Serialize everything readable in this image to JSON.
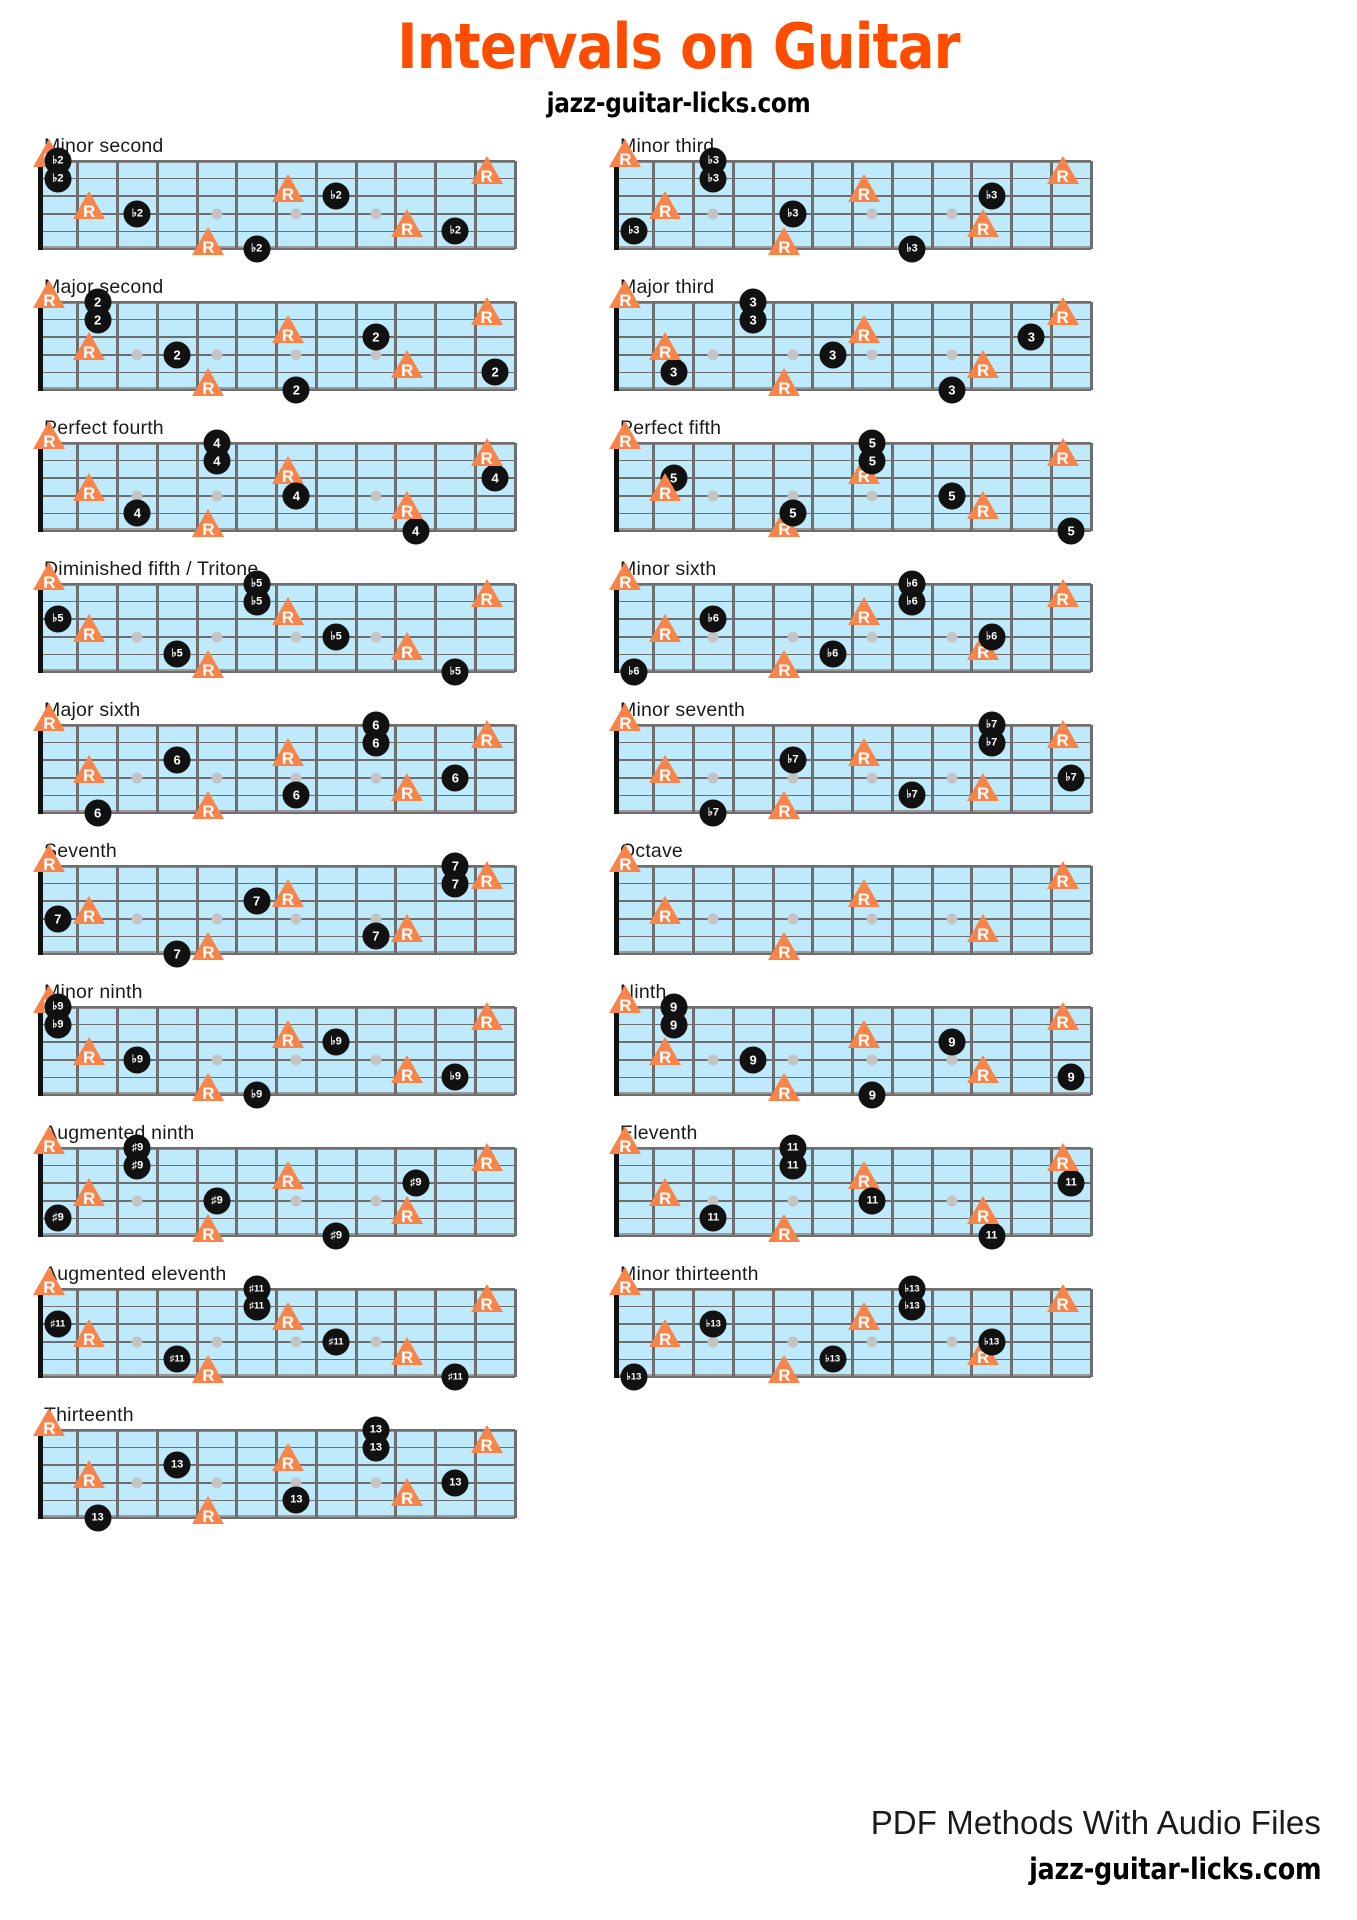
{
  "header": {
    "title": "Intervals on Guitar",
    "subtitle": "jazz-guitar-licks.com"
  },
  "footer": {
    "line1": "PDF Methods With Audio Files",
    "line2": "jazz-guitar-licks.com"
  },
  "fretboard": {
    "strings": 6,
    "frets": 12,
    "inlay_frets": [
      3,
      5,
      7,
      9
    ],
    "inlay_string_gap": "between string 3 and 4",
    "root_label": "R",
    "root_color": "#F8844A",
    "interval_color": "#111111",
    "board_color": "#BFEAFB"
  },
  "diagrams": [
    {
      "label": "Minor second",
      "interval_label": "♭2",
      "notes": [
        {
          "t": "R",
          "s": 6,
          "f": 0
        },
        {
          "t": "I",
          "s": 6,
          "f": 1
        },
        {
          "t": "R",
          "s": 1,
          "f": 5
        },
        {
          "t": "I",
          "s": 1,
          "f": 6
        },
        {
          "t": "R",
          "s": 4,
          "f": 7
        },
        {
          "t": "I",
          "s": 4,
          "f": 8
        },
        {
          "t": "R",
          "s": 2,
          "f": 10
        },
        {
          "t": "I",
          "s": 2,
          "f": 11
        },
        {
          "t": "R",
          "s": 5,
          "f": 12
        },
        {
          "t": "I",
          "s": 5,
          "f": 13
        },
        {
          "t": "R",
          "s": 3,
          "f": 14
        },
        {
          "t": "I",
          "s": 3,
          "f": 15
        }
      ]
    },
    {
      "label": "Minor third",
      "interval_label": "♭3",
      "notes": [
        {
          "t": "R",
          "s": 6,
          "f": 0
        },
        {
          "t": "I",
          "s": 6,
          "f": 3
        },
        {
          "t": "R",
          "s": 1,
          "f": 5
        },
        {
          "t": "I",
          "s": 1,
          "f": 8
        },
        {
          "t": "R",
          "s": 4,
          "f": 7
        },
        {
          "t": "I",
          "s": 4,
          "f": 10
        },
        {
          "t": "R",
          "s": 2,
          "f": 10
        },
        {
          "t": "I",
          "s": 2,
          "f": 13
        },
        {
          "t": "R",
          "s": 5,
          "f": 12
        },
        {
          "t": "I",
          "s": 5,
          "f": 15
        },
        {
          "t": "R",
          "s": 3,
          "f": 14
        },
        {
          "t": "I",
          "s": 3,
          "f": 17
        }
      ]
    },
    {
      "label": "Major second",
      "interval_label": "2",
      "notes": [
        {
          "t": "R",
          "s": 6,
          "f": 0
        },
        {
          "t": "I",
          "s": 6,
          "f": 2
        },
        {
          "t": "R",
          "s": 1,
          "f": 5
        },
        {
          "t": "I",
          "s": 1,
          "f": 7
        },
        {
          "t": "R",
          "s": 4,
          "f": 7
        },
        {
          "t": "I",
          "s": 4,
          "f": 9
        },
        {
          "t": "R",
          "s": 2,
          "f": 10
        },
        {
          "t": "I",
          "s": 2,
          "f": 12
        },
        {
          "t": "R",
          "s": 5,
          "f": 12
        },
        {
          "t": "I",
          "s": 5,
          "f": 14
        },
        {
          "t": "R",
          "s": 3,
          "f": 14
        },
        {
          "t": "I",
          "s": 3,
          "f": 16
        }
      ]
    },
    {
      "label": "Major third",
      "interval_label": "3",
      "notes": [
        {
          "t": "R",
          "s": 6,
          "f": 0
        },
        {
          "t": "I",
          "s": 6,
          "f": 4
        },
        {
          "t": "R",
          "s": 1,
          "f": 5
        },
        {
          "t": "I",
          "s": 1,
          "f": 9
        },
        {
          "t": "R",
          "s": 4,
          "f": 7
        },
        {
          "t": "I",
          "s": 4,
          "f": 11
        },
        {
          "t": "R",
          "s": 2,
          "f": 10
        },
        {
          "t": "I",
          "s": 2,
          "f": 14
        },
        {
          "t": "R",
          "s": 5,
          "f": 12
        },
        {
          "t": "I",
          "s": 5,
          "f": 16
        },
        {
          "t": "R",
          "s": 3,
          "f": 14
        },
        {
          "t": "I",
          "s": 3,
          "f": 18
        }
      ]
    },
    {
      "label": "Perfect fourth",
      "interval_label": "4",
      "notes": [
        {
          "t": "R",
          "s": 6,
          "f": 0
        },
        {
          "t": "I",
          "s": 6,
          "f": 5
        },
        {
          "t": "R",
          "s": 1,
          "f": 5
        },
        {
          "t": "I",
          "s": 1,
          "f": 10
        },
        {
          "t": "R",
          "s": 4,
          "f": 7
        },
        {
          "t": "I",
          "s": 4,
          "f": 12
        },
        {
          "t": "R",
          "s": 2,
          "f": 10
        },
        {
          "t": "I",
          "s": 2,
          "f": 15
        },
        {
          "t": "R",
          "s": 5,
          "f": 12
        },
        {
          "t": "I",
          "s": 5,
          "f": 17
        },
        {
          "t": "R",
          "s": 3,
          "f": 14
        },
        {
          "t": "I",
          "s": 3,
          "f": 19
        }
      ]
    },
    {
      "label": "Perfect fifth",
      "interval_label": "5",
      "notes": [
        {
          "t": "R",
          "s": 6,
          "f": 0
        },
        {
          "t": "I",
          "s": 6,
          "f": 7
        },
        {
          "t": "R",
          "s": 1,
          "f": 5
        },
        {
          "t": "I",
          "s": 1,
          "f": 12
        },
        {
          "t": "R",
          "s": 4,
          "f": 7
        },
        {
          "t": "I",
          "s": 4,
          "f": 14
        },
        {
          "t": "R",
          "s": 2,
          "f": 10
        },
        {
          "t": "I",
          "s": 2,
          "f": 17
        },
        {
          "t": "R",
          "s": 5,
          "f": 12
        },
        {
          "t": "I",
          "s": 5,
          "f": 19
        },
        {
          "t": "R",
          "s": 3,
          "f": 14
        },
        {
          "t": "I",
          "s": 3,
          "f": 21
        }
      ]
    },
    {
      "label": "Diminished fifth / Tritone",
      "interval_label": "♭5",
      "notes": [
        {
          "t": "R",
          "s": 6,
          "f": 0
        },
        {
          "t": "I",
          "s": 6,
          "f": 6
        },
        {
          "t": "R",
          "s": 1,
          "f": 5
        },
        {
          "t": "I",
          "s": 1,
          "f": 11
        },
        {
          "t": "R",
          "s": 4,
          "f": 7
        },
        {
          "t": "I",
          "s": 4,
          "f": 13
        },
        {
          "t": "R",
          "s": 2,
          "f": 10
        },
        {
          "t": "I",
          "s": 2,
          "f": 16
        },
        {
          "t": "R",
          "s": 5,
          "f": 12
        },
        {
          "t": "I",
          "s": 5,
          "f": 18
        },
        {
          "t": "R",
          "s": 3,
          "f": 14
        },
        {
          "t": "I",
          "s": 3,
          "f": 20
        }
      ]
    },
    {
      "label": "Minor sixth",
      "interval_label": "♭6",
      "notes": [
        {
          "t": "R",
          "s": 6,
          "f": 0
        },
        {
          "t": "I",
          "s": 6,
          "f": 8
        },
        {
          "t": "R",
          "s": 1,
          "f": 5
        },
        {
          "t": "I",
          "s": 1,
          "f": 13
        },
        {
          "t": "R",
          "s": 4,
          "f": 7
        },
        {
          "t": "I",
          "s": 4,
          "f": 15
        },
        {
          "t": "R",
          "s": 2,
          "f": 10
        },
        {
          "t": "I",
          "s": 2,
          "f": 18
        },
        {
          "t": "R",
          "s": 5,
          "f": 12
        },
        {
          "t": "I",
          "s": 5,
          "f": 20
        },
        {
          "t": "R",
          "s": 3,
          "f": 14
        },
        {
          "t": "I",
          "s": 3,
          "f": 22
        }
      ]
    },
    {
      "label": "Major sixth",
      "interval_label": "6",
      "notes": [
        {
          "t": "R",
          "s": 6,
          "f": 0
        },
        {
          "t": "I",
          "s": 6,
          "f": 9
        },
        {
          "t": "R",
          "s": 1,
          "f": 5
        },
        {
          "t": "I",
          "s": 1,
          "f": 14
        },
        {
          "t": "R",
          "s": 4,
          "f": 7
        },
        {
          "t": "I",
          "s": 4,
          "f": 16
        },
        {
          "t": "R",
          "s": 2,
          "f": 10
        },
        {
          "t": "I",
          "s": 2,
          "f": 19
        },
        {
          "t": "R",
          "s": 5,
          "f": 12
        },
        {
          "t": "I",
          "s": 5,
          "f": 21
        },
        {
          "t": "R",
          "s": 3,
          "f": 14
        },
        {
          "t": "I",
          "s": 3,
          "f": 23
        }
      ]
    },
    {
      "label": "Minor seventh",
      "interval_label": "♭7",
      "notes": [
        {
          "t": "R",
          "s": 6,
          "f": 0
        },
        {
          "t": "I",
          "s": 6,
          "f": 10
        },
        {
          "t": "R",
          "s": 1,
          "f": 5
        },
        {
          "t": "I",
          "s": 1,
          "f": 15
        },
        {
          "t": "R",
          "s": 4,
          "f": 7
        },
        {
          "t": "I",
          "s": 4,
          "f": 17
        },
        {
          "t": "R",
          "s": 2,
          "f": 10
        },
        {
          "t": "I",
          "s": 2,
          "f": 20
        },
        {
          "t": "R",
          "s": 5,
          "f": 12
        },
        {
          "t": "I",
          "s": 5,
          "f": 22
        },
        {
          "t": "R",
          "s": 3,
          "f": 14
        },
        {
          "t": "I",
          "s": 3,
          "f": 24
        }
      ]
    },
    {
      "label": "Seventh",
      "interval_label": "7",
      "notes": [
        {
          "t": "R",
          "s": 6,
          "f": 0
        },
        {
          "t": "I",
          "s": 6,
          "f": 11
        },
        {
          "t": "R",
          "s": 1,
          "f": 5
        },
        {
          "t": "I",
          "s": 1,
          "f": 16
        },
        {
          "t": "R",
          "s": 4,
          "f": 7
        },
        {
          "t": "I",
          "s": 4,
          "f": 18
        },
        {
          "t": "R",
          "s": 2,
          "f": 10
        },
        {
          "t": "I",
          "s": 2,
          "f": 21
        },
        {
          "t": "R",
          "s": 5,
          "f": 12
        },
        {
          "t": "I",
          "s": 5,
          "f": 23
        },
        {
          "t": "R",
          "s": 3,
          "f": 14
        },
        {
          "t": "I",
          "s": 3,
          "f": 25
        }
      ]
    },
    {
      "label": "Octave",
      "interval_label": "",
      "notes": [
        {
          "t": "R",
          "s": 6,
          "f": 0
        },
        {
          "t": "R",
          "s": 1,
          "f": 5
        },
        {
          "t": "R",
          "s": 4,
          "f": 7
        },
        {
          "t": "R",
          "s": 2,
          "f": 10
        },
        {
          "t": "R",
          "s": 5,
          "f": 12
        },
        {
          "t": "R",
          "s": 3,
          "f": 14
        }
      ]
    },
    {
      "label": "Minor ninth",
      "interval_label": "♭9",
      "notes": [
        {
          "t": "R",
          "s": 6,
          "f": 0
        },
        {
          "t": "I",
          "s": 6,
          "f": 1
        },
        {
          "t": "R",
          "s": 1,
          "f": 5
        },
        {
          "t": "I",
          "s": 1,
          "f": 6
        },
        {
          "t": "R",
          "s": 4,
          "f": 7
        },
        {
          "t": "I",
          "s": 4,
          "f": 8
        },
        {
          "t": "R",
          "s": 2,
          "f": 10
        },
        {
          "t": "I",
          "s": 2,
          "f": 11
        },
        {
          "t": "R",
          "s": 5,
          "f": 12
        },
        {
          "t": "I",
          "s": 5,
          "f": 13
        },
        {
          "t": "R",
          "s": 3,
          "f": 14
        },
        {
          "t": "I",
          "s": 3,
          "f": 15
        }
      ]
    },
    {
      "label": "Ninth",
      "interval_label": "9",
      "notes": [
        {
          "t": "R",
          "s": 6,
          "f": 0
        },
        {
          "t": "I",
          "s": 6,
          "f": 2
        },
        {
          "t": "R",
          "s": 1,
          "f": 5
        },
        {
          "t": "I",
          "s": 1,
          "f": 7
        },
        {
          "t": "R",
          "s": 4,
          "f": 7
        },
        {
          "t": "I",
          "s": 4,
          "f": 9
        },
        {
          "t": "R",
          "s": 2,
          "f": 10
        },
        {
          "t": "I",
          "s": 2,
          "f": 12
        },
        {
          "t": "R",
          "s": 5,
          "f": 12
        },
        {
          "t": "I",
          "s": 5,
          "f": 14
        },
        {
          "t": "R",
          "s": 3,
          "f": 14
        },
        {
          "t": "I",
          "s": 3,
          "f": 16
        }
      ]
    },
    {
      "label": "Augmented ninth",
      "interval_label": "♯9",
      "notes": [
        {
          "t": "R",
          "s": 6,
          "f": 0
        },
        {
          "t": "I",
          "s": 6,
          "f": 3
        },
        {
          "t": "R",
          "s": 1,
          "f": 5
        },
        {
          "t": "I",
          "s": 1,
          "f": 8
        },
        {
          "t": "R",
          "s": 4,
          "f": 7
        },
        {
          "t": "I",
          "s": 4,
          "f": 10
        },
        {
          "t": "R",
          "s": 2,
          "f": 10
        },
        {
          "t": "I",
          "s": 2,
          "f": 13
        },
        {
          "t": "R",
          "s": 5,
          "f": 12
        },
        {
          "t": "I",
          "s": 5,
          "f": 15
        },
        {
          "t": "R",
          "s": 3,
          "f": 14
        },
        {
          "t": "I",
          "s": 3,
          "f": 17
        }
      ]
    },
    {
      "label": "Eleventh",
      "interval_label": "11",
      "notes": [
        {
          "t": "R",
          "s": 6,
          "f": 0
        },
        {
          "t": "I",
          "s": 6,
          "f": 5
        },
        {
          "t": "R",
          "s": 1,
          "f": 5
        },
        {
          "t": "I",
          "s": 1,
          "f": 10
        },
        {
          "t": "R",
          "s": 4,
          "f": 7
        },
        {
          "t": "I",
          "s": 4,
          "f": 12
        },
        {
          "t": "R",
          "s": 2,
          "f": 10
        },
        {
          "t": "I",
          "s": 2,
          "f": 15
        },
        {
          "t": "R",
          "s": 5,
          "f": 12
        },
        {
          "t": "I",
          "s": 5,
          "f": 17
        },
        {
          "t": "R",
          "s": 3,
          "f": 14
        },
        {
          "t": "I",
          "s": 3,
          "f": 19
        }
      ]
    },
    {
      "label": "Augmented eleventh",
      "interval_label": "♯11",
      "notes": [
        {
          "t": "R",
          "s": 6,
          "f": 0
        },
        {
          "t": "I",
          "s": 6,
          "f": 6
        },
        {
          "t": "R",
          "s": 1,
          "f": 5
        },
        {
          "t": "I",
          "s": 1,
          "f": 11
        },
        {
          "t": "R",
          "s": 4,
          "f": 7
        },
        {
          "t": "I",
          "s": 4,
          "f": 13
        },
        {
          "t": "R",
          "s": 2,
          "f": 10
        },
        {
          "t": "I",
          "s": 2,
          "f": 16
        },
        {
          "t": "R",
          "s": 5,
          "f": 12
        },
        {
          "t": "I",
          "s": 5,
          "f": 18
        },
        {
          "t": "R",
          "s": 3,
          "f": 14
        },
        {
          "t": "I",
          "s": 3,
          "f": 20
        }
      ]
    },
    {
      "label": "Minor thirteenth",
      "interval_label": "♭13",
      "notes": [
        {
          "t": "R",
          "s": 6,
          "f": 0
        },
        {
          "t": "I",
          "s": 6,
          "f": 8
        },
        {
          "t": "R",
          "s": 1,
          "f": 5
        },
        {
          "t": "I",
          "s": 1,
          "f": 13
        },
        {
          "t": "R",
          "s": 4,
          "f": 7
        },
        {
          "t": "I",
          "s": 4,
          "f": 15
        },
        {
          "t": "R",
          "s": 2,
          "f": 10
        },
        {
          "t": "I",
          "s": 2,
          "f": 18
        },
        {
          "t": "R",
          "s": 5,
          "f": 12
        },
        {
          "t": "I",
          "s": 5,
          "f": 20
        },
        {
          "t": "R",
          "s": 3,
          "f": 14
        },
        {
          "t": "I",
          "s": 3,
          "f": 22
        }
      ]
    },
    {
      "label": "Thirteenth",
      "interval_label": "13",
      "notes": [
        {
          "t": "R",
          "s": 6,
          "f": 0
        },
        {
          "t": "I",
          "s": 6,
          "f": 9
        },
        {
          "t": "R",
          "s": 1,
          "f": 5
        },
        {
          "t": "I",
          "s": 1,
          "f": 14
        },
        {
          "t": "R",
          "s": 4,
          "f": 7
        },
        {
          "t": "I",
          "s": 4,
          "f": 16
        },
        {
          "t": "R",
          "s": 2,
          "f": 10
        },
        {
          "t": "I",
          "s": 2,
          "f": 19
        },
        {
          "t": "R",
          "s": 5,
          "f": 12
        },
        {
          "t": "I",
          "s": 5,
          "f": 21
        },
        {
          "t": "R",
          "s": 3,
          "f": 14
        },
        {
          "t": "I",
          "s": 3,
          "f": 23
        }
      ]
    }
  ]
}
